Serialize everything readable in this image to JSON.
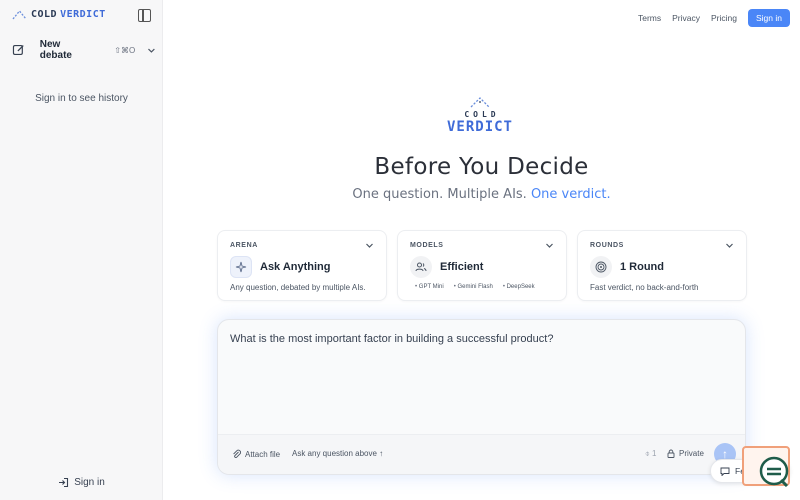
{
  "brand": {
    "cold": "COLD",
    "verdict": "VERDICT"
  },
  "sidebar": {
    "new_debate_label": "New debate",
    "new_debate_shortcut": "⇧⌘O",
    "history_hint": "Sign in to see history",
    "signin_label": "Sign in"
  },
  "topnav": {
    "links": [
      "Terms",
      "Privacy",
      "Pricing"
    ],
    "signin_label": "Sign in"
  },
  "hero": {
    "logo_cold": "COLD",
    "logo_verdict": "VERDICT",
    "title": "Before You Decide",
    "subtitle_prefix": "One question. Multiple AIs.",
    "subtitle_accent": "One verdict."
  },
  "cards": {
    "arena": {
      "heading": "ARENA",
      "title": "Ask Anything",
      "desc": "Any question, debated by multiple AIs."
    },
    "models": {
      "heading": "MODELS",
      "title": "Efficient",
      "models": [
        "GPT Mini",
        "Gemini Flash",
        "DeepSeek"
      ]
    },
    "rounds": {
      "heading": "ROUNDS",
      "title": "1 Round",
      "desc": "Fast verdict, no back-and-forth"
    }
  },
  "prompt": {
    "text": "What is the most important factor in building a successful product?",
    "attach_label": "Attach file",
    "hint": "Ask any question above ↑",
    "count": "1",
    "private_label": "Private",
    "send_icon": "↑"
  },
  "feedback": {
    "label": "Feedback"
  },
  "colors": {
    "accent": "#4a86f7",
    "brand_dark": "#2b3a55",
    "brand_blue": "#3f6bd8"
  }
}
